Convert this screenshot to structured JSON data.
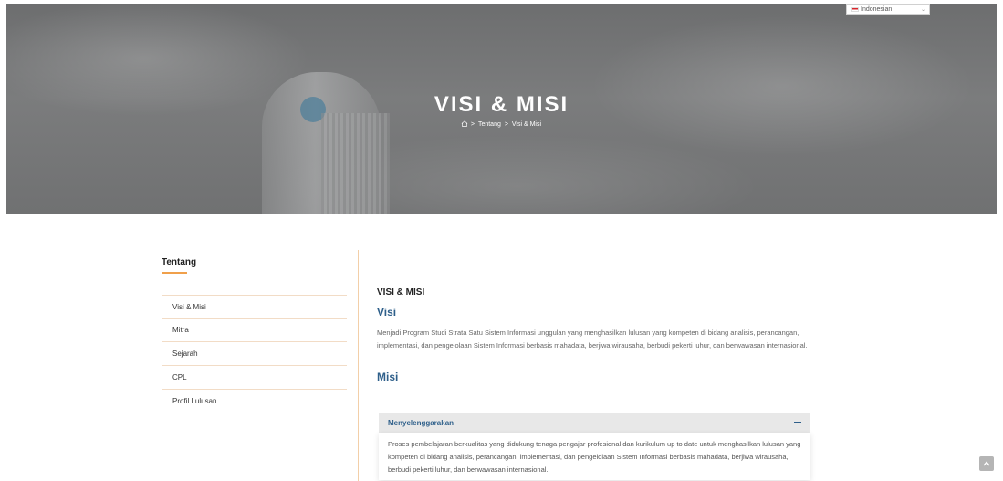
{
  "language": {
    "selected": "Indonesian"
  },
  "hero": {
    "title": "VISI & MISI",
    "breadcrumb": [
      "Tentang",
      "Visi & Misi"
    ],
    "separator": ">"
  },
  "sidebar": {
    "title": "Tentang",
    "items": [
      {
        "label": "Visi & Misi"
      },
      {
        "label": "Mitra"
      },
      {
        "label": "Sejarah"
      },
      {
        "label": "CPL"
      },
      {
        "label": "Profil Lulusan"
      }
    ]
  },
  "main": {
    "title": "VISI & MISI",
    "visi_heading": "Visi",
    "visi_text": "Menjadi Program Studi Strata Satu Sistem Informasi unggulan yang menghasilkan lulusan yang kompeten di bidang analisis, perancangan, implementasi, dan pengelolaan Sistem Informasi berbasis mahadata, berjiwa wirausaha, berbudi pekerti luhur, dan berwawasan internasional.",
    "misi_heading": "Misi",
    "accordion": [
      {
        "label": "Menyelenggarakan",
        "body": "Proses pembelajaran berkualitas yang didukung tenaga pengajar profesional dan kurikulum up to date untuk menghasilkan lulusan yang kompeten di bidang analisis, perancangan, implementasi, dan pengelolaan Sistem Informasi berbasis mahadata, berjiwa wirausaha, berbudi pekerti luhur, dan berwawasan internasional."
      }
    ]
  },
  "colors": {
    "accent": "#2e5f8a",
    "underline": "#f0a04b",
    "divider": "#f3cfa8"
  }
}
